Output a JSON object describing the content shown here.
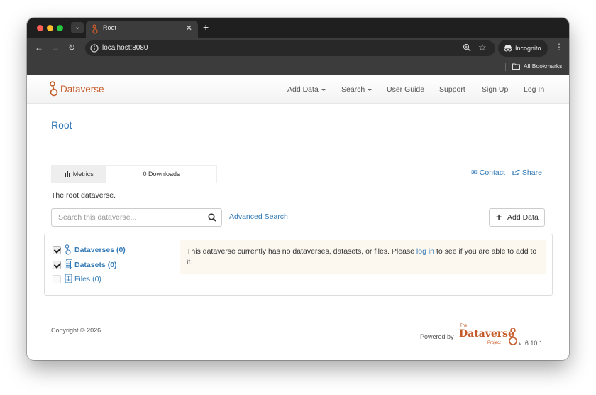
{
  "browser": {
    "tab_title": "Root",
    "url": "localhost:8080",
    "incognito_label": "Incognito",
    "bookmarks_label": "All Bookmarks",
    "icons": [
      "tab-search-icon",
      "back-icon",
      "forward-icon",
      "reload-icon",
      "site-info-icon",
      "zoom-icon",
      "star-icon",
      "incognito-icon",
      "kebab-icon",
      "folder-icon"
    ]
  },
  "navbar": {
    "brand": "Dataverse",
    "links": {
      "add_data": "Add Data",
      "search": "Search",
      "user_guide": "User Guide",
      "support": "Support",
      "sign_up": "Sign Up",
      "log_in": "Log In"
    }
  },
  "dataverse": {
    "title": "Root",
    "description": "The root dataverse."
  },
  "metrics": {
    "tab_label": "Metrics",
    "downloads": "0 Downloads"
  },
  "actions": {
    "contact": "Contact",
    "share": "Share"
  },
  "search": {
    "placeholder": "Search this dataverse...",
    "advanced": "Advanced Search",
    "add_data": "Add Data"
  },
  "facets": [
    {
      "label": "Dataverses (0)",
      "checked": true,
      "icon": "dataverse-icon"
    },
    {
      "label": "Datasets (0)",
      "checked": true,
      "icon": "dataset-icon"
    },
    {
      "label": "Files (0)",
      "checked": false,
      "icon": "file-icon"
    }
  ],
  "notice": {
    "before": "This dataverse currently has no dataverses, datasets, or files. Please ",
    "link": "log in",
    "after": " to see if you are able to add to it."
  },
  "footer": {
    "copyright": "Copyright © 2026",
    "powered_by": "Powered by",
    "logo_the": "The",
    "logo_name": "Dataverse",
    "logo_project": "Project",
    "version": "v. 6.10.1"
  },
  "colors": {
    "brand": "#c55b28",
    "link": "#337ab7"
  }
}
